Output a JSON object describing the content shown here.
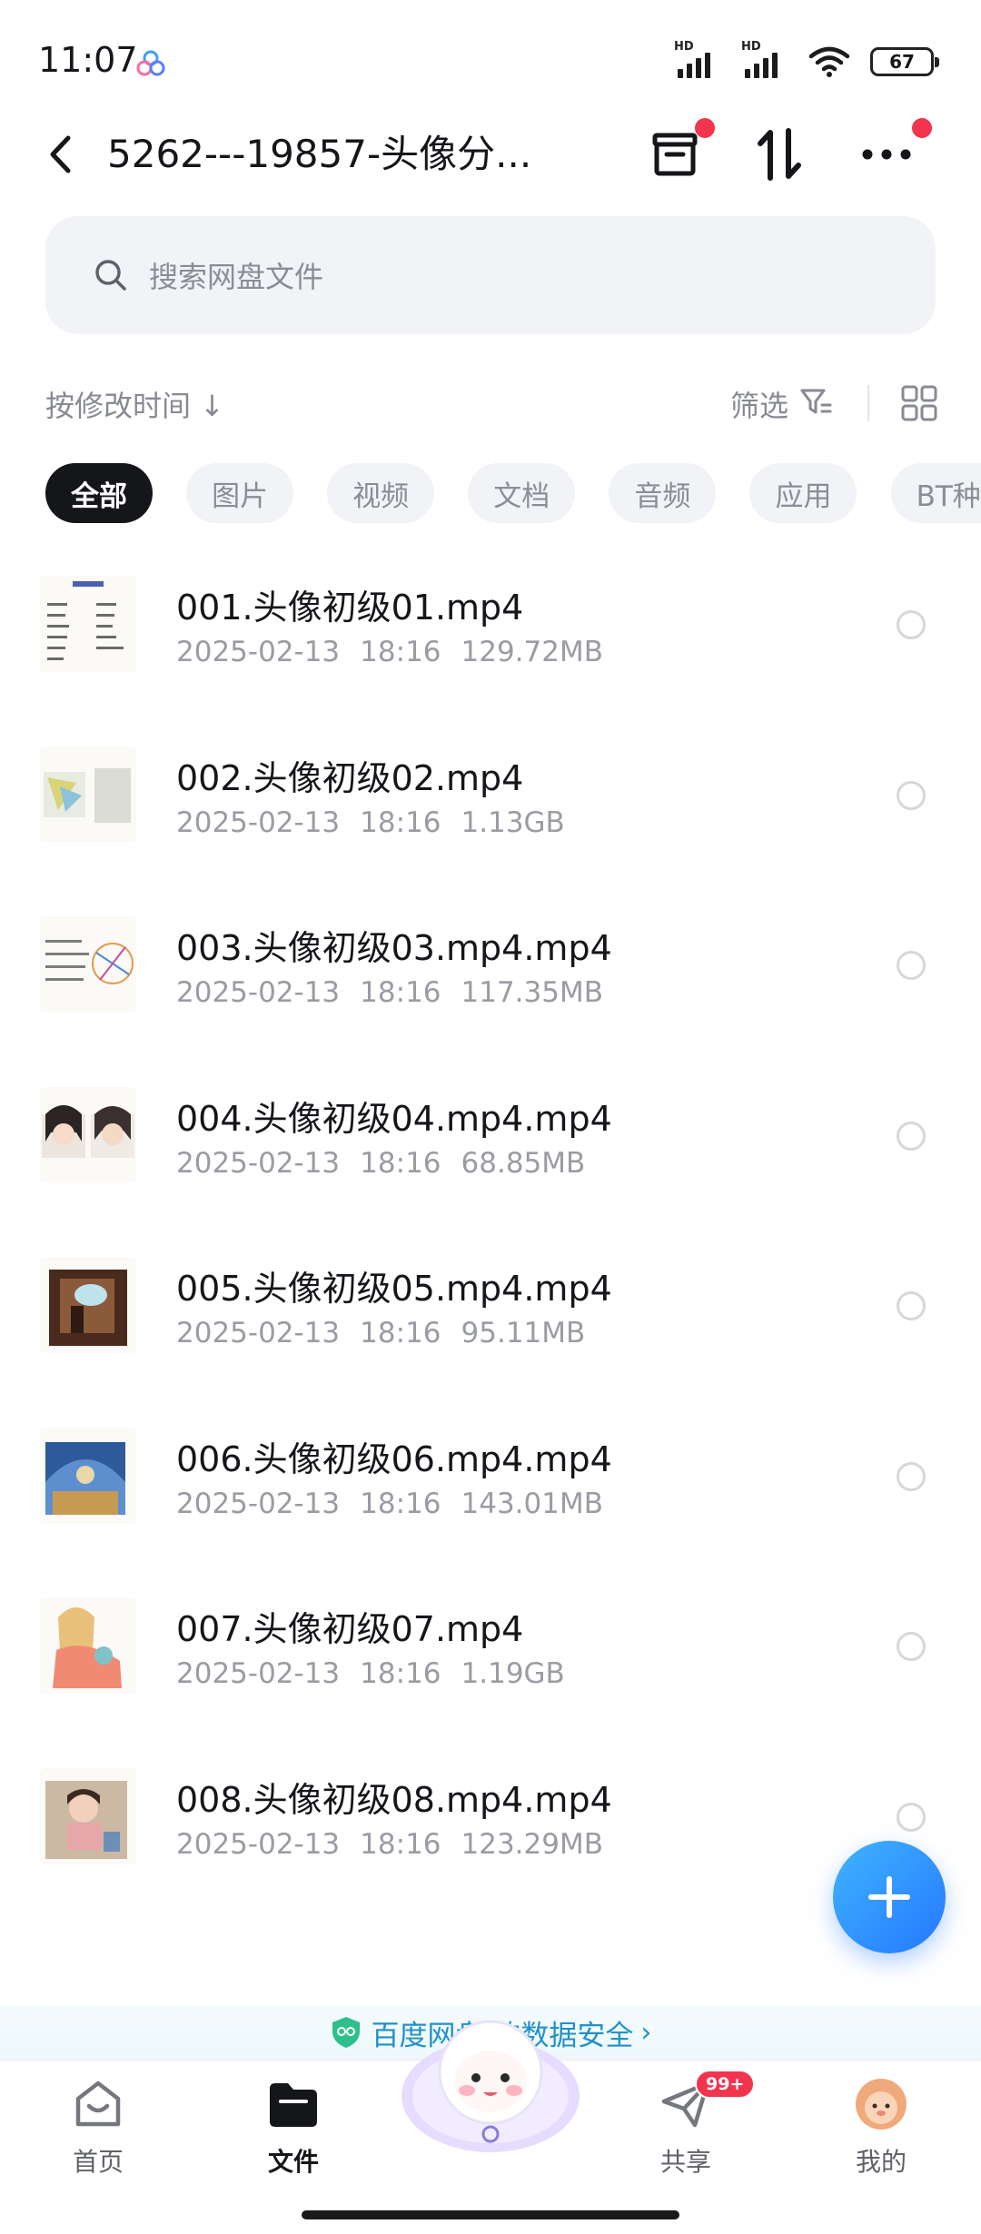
{
  "status_bar": {
    "time": "11:07",
    "signal_label": "HD",
    "battery": "67"
  },
  "header": {
    "title": "5262---19857-头像分...",
    "icons": [
      "back-icon",
      "archive-icon",
      "transfer-icon",
      "more-icon"
    ]
  },
  "search": {
    "placeholder": "搜索网盘文件"
  },
  "sort": {
    "label": "按修改时间 ↓",
    "filter_label": "筛选"
  },
  "categories": [
    "全部",
    "图片",
    "视频",
    "文档",
    "音频",
    "应用",
    "BT种子"
  ],
  "files": [
    {
      "name": "001.头像初级01.mp4",
      "date": "2025-02-13",
      "time": "18:16",
      "size": "129.72MB"
    },
    {
      "name": "002.头像初级02.mp4",
      "date": "2025-02-13",
      "time": "18:16",
      "size": "1.13GB"
    },
    {
      "name": "003.头像初级03.mp4.mp4",
      "date": "2025-02-13",
      "time": "18:16",
      "size": "117.35MB"
    },
    {
      "name": "004.头像初级04.mp4.mp4",
      "date": "2025-02-13",
      "time": "18:16",
      "size": "68.85MB"
    },
    {
      "name": "005.头像初级05.mp4.mp4",
      "date": "2025-02-13",
      "time": "18:16",
      "size": "95.11MB"
    },
    {
      "name": "006.头像初级06.mp4.mp4",
      "date": "2025-02-13",
      "time": "18:16",
      "size": "143.01MB"
    },
    {
      "name": "007.头像初级07.mp4",
      "date": "2025-02-13",
      "time": "18:16",
      "size": "1.19GB"
    },
    {
      "name": "008.头像初级08.mp4.mp4",
      "date": "2025-02-13",
      "time": "18:16",
      "size": "123.29MB"
    }
  ],
  "banner": {
    "text": "百度网盘 的数据安全"
  },
  "bottom_nav": {
    "items": [
      "首页",
      "文件",
      "共享",
      "我的"
    ],
    "share_badge": "99+"
  },
  "colors": {
    "accent_blue": "#2678ff",
    "badge_red": "#f2344f",
    "banner_text": "#2190c9"
  }
}
